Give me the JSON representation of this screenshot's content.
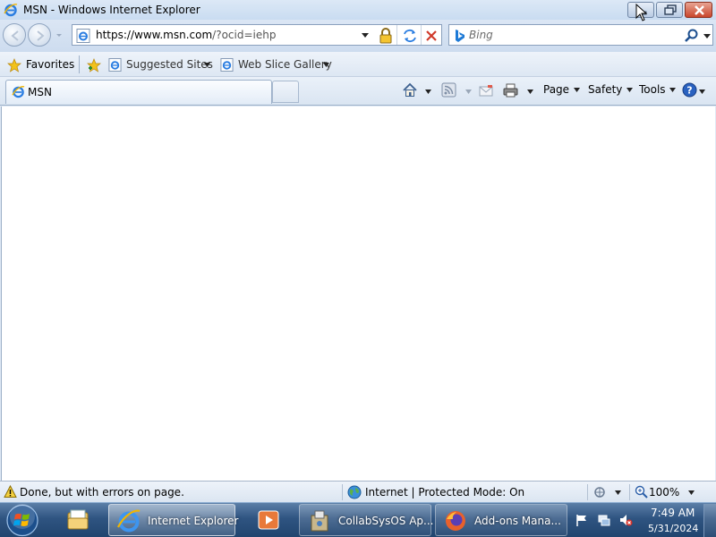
{
  "window": {
    "title": "MSN - Windows Internet Explorer"
  },
  "address_bar": {
    "url_host": "https://www.msn.com",
    "url_rest": "/?ocid=iehp"
  },
  "search": {
    "placeholder": "Bing"
  },
  "favorites_bar": {
    "favorites_label": "Favorites",
    "links": [
      {
        "label": "Suggested Sites"
      },
      {
        "label": "Web Slice Gallery"
      }
    ]
  },
  "tabs": [
    {
      "label": "MSN",
      "active": true
    }
  ],
  "command_bar": {
    "page_label": "Page",
    "safety_label": "Safety",
    "tools_label": "Tools"
  },
  "status_bar": {
    "status_text": "Done, but with errors on page.",
    "zone_text": "Internet | Protected Mode: On",
    "zoom_text": "100%"
  },
  "taskbar": {
    "items": [
      {
        "label": "Internet Explorer",
        "state": "active"
      },
      {
        "label": "CollabSysOS Ap..."
      },
      {
        "label": "Add-ons Mana..."
      }
    ],
    "clock_time": "7:49 AM",
    "clock_date": "5/31/2024"
  }
}
